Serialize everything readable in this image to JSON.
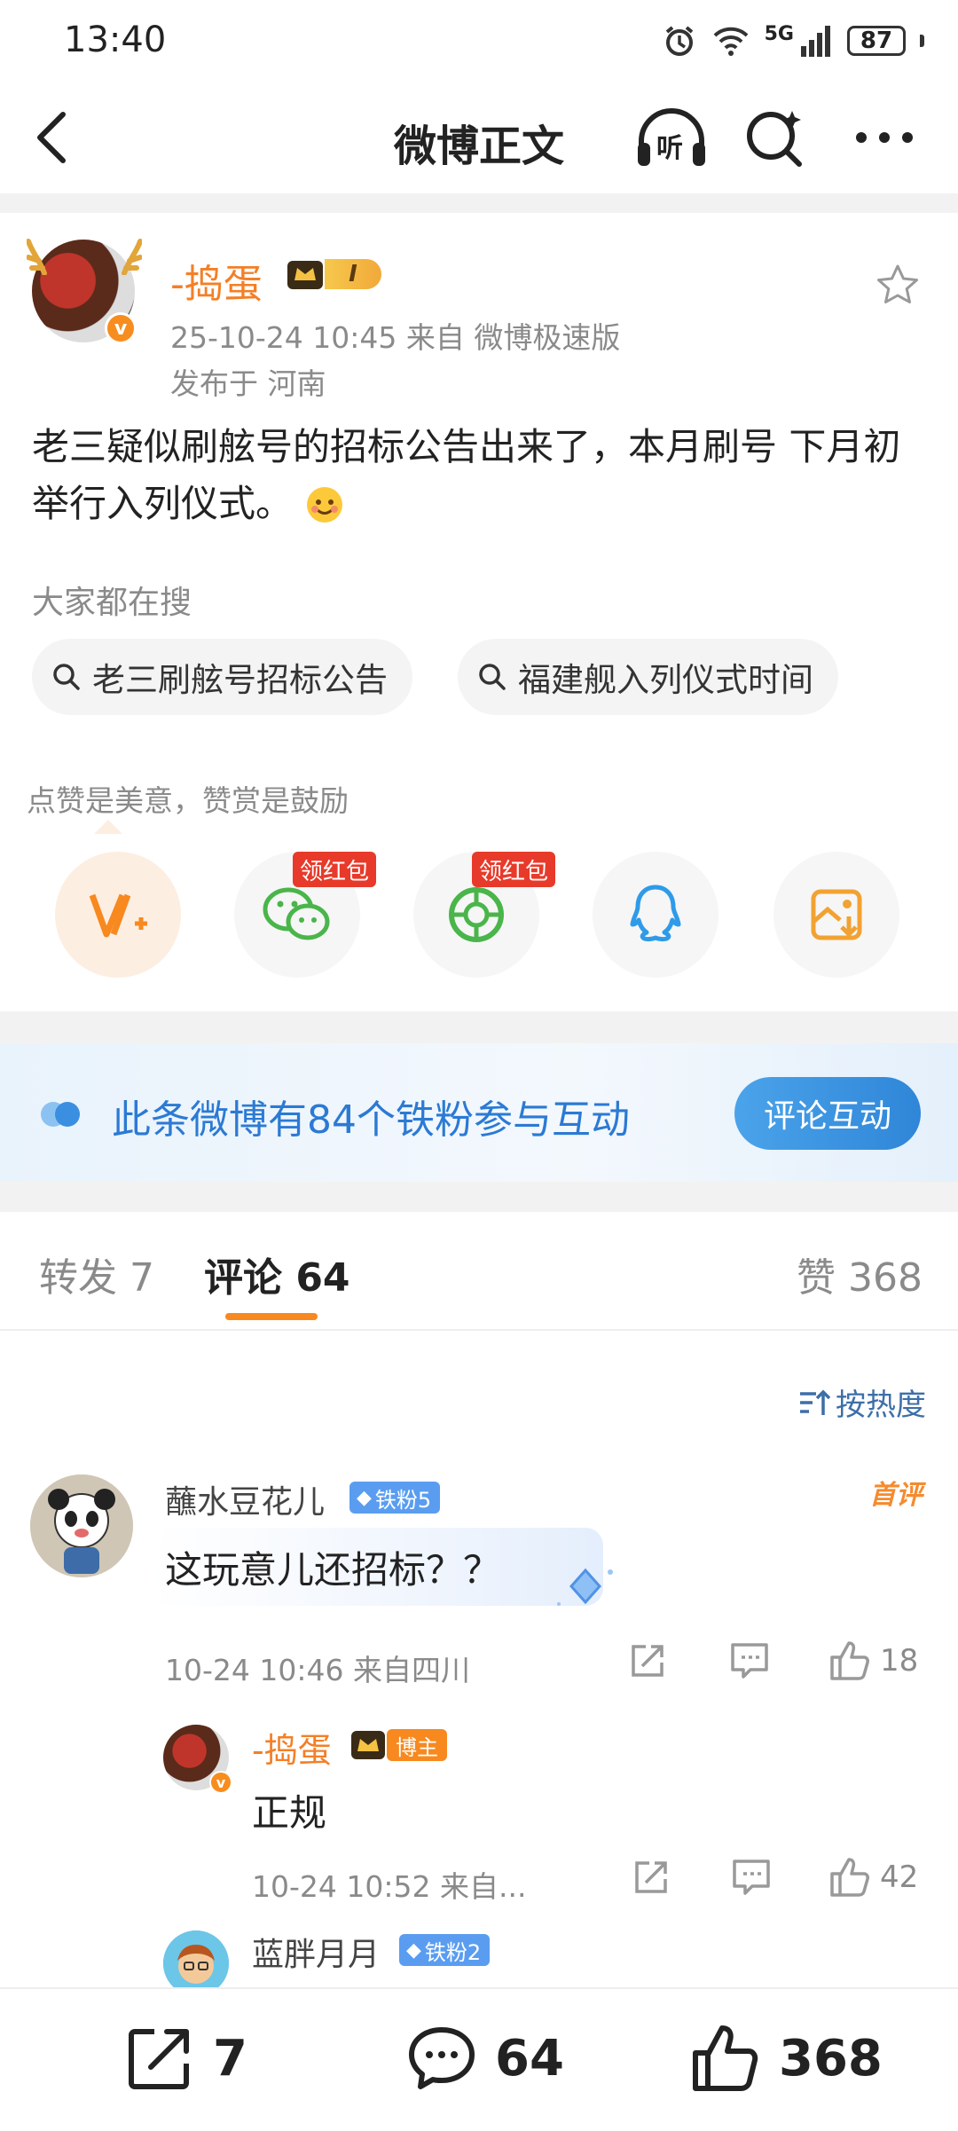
{
  "status_bar": {
    "time": "13:40",
    "network": "5G",
    "battery": "87"
  },
  "nav": {
    "title": "微博正文",
    "listen_label": "听"
  },
  "post": {
    "author": "-捣蛋",
    "level": "I",
    "datetime_source": "25-10-24 10:45   来自 微博极速版",
    "location": "发布于 河南",
    "text": "老三疑似刷舷号的招标公告出来了，本月刷号 下月初举行入列仪式。",
    "search_label": "大家都在搜",
    "search_chips": [
      "老三刷舷号招标公告",
      "福建舰入列仪式时间"
    ],
    "like_tip": "点赞是美意，赞赏是鼓励",
    "share_targets": [
      "reward-icon",
      "wechat-icon",
      "moments-icon",
      "qq-icon",
      "save-image-icon"
    ],
    "red_packet_label": "领红包"
  },
  "fans_banner": {
    "text": "此条微博有84个铁粉参与互动",
    "button": "评论互动"
  },
  "tabs": {
    "repost": "转发 7",
    "comment": "评论 64",
    "like": "赞 368"
  },
  "sort_label": "按热度",
  "comments": [
    {
      "name": "蘸水豆花儿",
      "badge": "铁粉5",
      "text": "这玩意儿还招标？？",
      "tag": "首评",
      "meta": "10-24 10:46  来自四川",
      "likes": "18",
      "reply": {
        "name": "-捣蛋",
        "badge": "博主",
        "text": "正规",
        "meta": "10-24 10:52  来自...",
        "likes": "42"
      }
    },
    {
      "name": "蓝胖月月",
      "badge": "铁粉2"
    }
  ],
  "bottom_bar": {
    "repost": "7",
    "comment": "64",
    "like": "368"
  },
  "colors": {
    "accent": "#f7891f",
    "link_blue": "#2b7ad4",
    "red_tag": "#e83a2a",
    "fan_badge": "#5a9df0"
  }
}
